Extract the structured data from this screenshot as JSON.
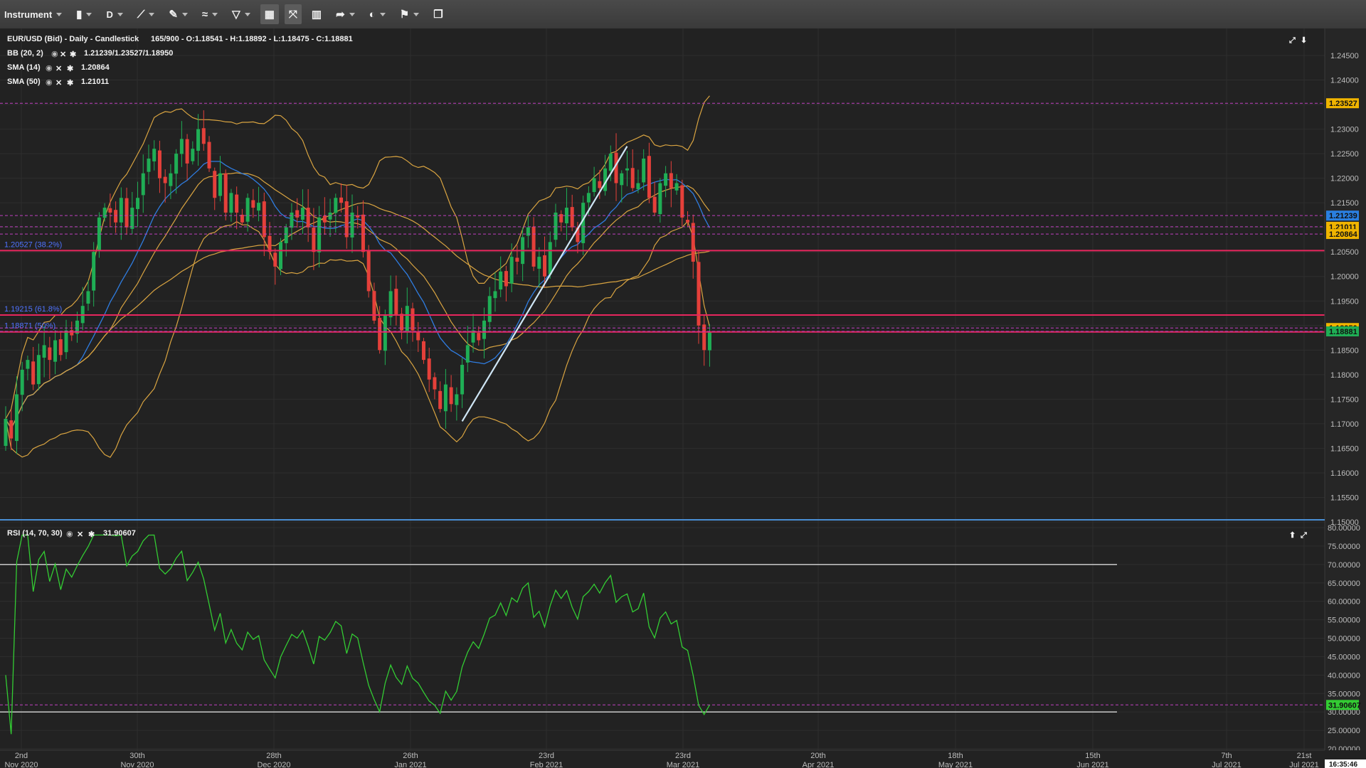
{
  "toolbar": {
    "instrument_label": "Instrument",
    "timeframe_label": "D",
    "icons": [
      "candlestick-type-icon",
      "line-draw-icon",
      "pencil-icon",
      "indicator-icon",
      "shape-icon",
      "layout-icon",
      "fullscreen-icon",
      "bar-chart-icon",
      "share-arrow-icon",
      "theme-icon",
      "uk-flag-icon",
      "detach-window-icon"
    ]
  },
  "header": {
    "instrument": "EUR/USD (Bid) - Daily - Candlestick",
    "ohlc": "165/900 - O:1.18541 - H:1.18892 - L:1.18475 - C:1.18881",
    "bb_label": "BB (20, 2)",
    "bb_values": "1.21239/1.23527/1.18950",
    "sma14_label": "SMA (14)",
    "sma14_value": "1.20864",
    "sma50_label": "SMA (50)",
    "sma50_value": "1.21011"
  },
  "rsi_header": {
    "label": "RSI (14, 70, 30)",
    "value": "31.90607"
  },
  "fib_labels": [
    {
      "text": "1.20527 (38.2%)",
      "price": 1.20527
    },
    {
      "text": "1.18871 (50%)",
      "price": 1.18871
    },
    {
      "text": "1.19215 (61.8%)",
      "price": 1.19215
    }
  ],
  "price_badges": [
    {
      "text": "1.23527",
      "price": 1.23527,
      "color": "#f0b400"
    },
    {
      "text": "1.21239",
      "price": 1.21239,
      "color": "#2a7fe0"
    },
    {
      "text": "1.21011",
      "price": 1.21011,
      "color": "#f0b400"
    },
    {
      "text": "1.20864",
      "price": 1.20864,
      "color": "#f0b400"
    },
    {
      "text": "1.18950",
      "price": 1.1895,
      "color": "#f0b400"
    },
    {
      "text": "1.18881",
      "price": 1.18881,
      "color": "#1fae55"
    }
  ],
  "rsi_badge": {
    "text": "31.90607",
    "value": 31.90607,
    "color": "#33cc33"
  },
  "date_ticks": [
    {
      "day": "2nd",
      "month": "Nov 2020"
    },
    {
      "day": "30th",
      "month": "Nov 2020"
    },
    {
      "day": "28th",
      "month": "Dec 2020"
    },
    {
      "day": "26th",
      "month": "Jan 2021"
    },
    {
      "day": "23rd",
      "month": "Feb 2021"
    },
    {
      "day": "23rd",
      "month": "Mar 2021"
    },
    {
      "day": "20th",
      "month": "Apr 2021"
    },
    {
      "day": "18th",
      "month": "May 2021"
    },
    {
      "day": "15th",
      "month": "Jun 2021"
    },
    {
      "day": "7th",
      "month": "Jul 2021"
    },
    {
      "day": "21st",
      "month": "Jul 2021"
    }
  ],
  "time_readout": "16:35:46",
  "colors": {
    "up": "#1fae55",
    "down": "#e5403a",
    "bb": "#d9a441",
    "sma14": "#2f7de1",
    "sma50": "#d9a441",
    "rsi": "#33cc33",
    "fib": "#e8265e",
    "dashed": "#c040c0"
  },
  "chart_data": [
    {
      "type": "candlestick",
      "title": "EUR/USD (Bid) - Daily - Candlestick",
      "x": [
        "2020-11-02",
        "2020-11-30",
        "2020-12-28",
        "2021-01-26",
        "2021-02-23",
        "2021-03-23",
        "2021-04-20",
        "2021-05-18",
        "2021-06-15",
        "2021-07-07",
        "2021-07-21"
      ],
      "ylim": [
        1.15,
        1.245
      ],
      "y_ticks": [
        1.15,
        1.155,
        1.16,
        1.165,
        1.17,
        1.175,
        1.18,
        1.185,
        1.19,
        1.195,
        1.2,
        1.205,
        1.21,
        1.215,
        1.22,
        1.225,
        1.23,
        1.235,
        1.24,
        1.245
      ],
      "close_series": [
        1.171,
        1.167,
        1.176,
        1.181,
        1.183,
        1.178,
        1.184,
        1.186,
        1.183,
        1.187,
        1.184,
        1.189,
        1.188,
        1.191,
        1.194,
        1.197,
        1.205,
        1.212,
        1.214,
        1.213,
        1.211,
        1.216,
        1.21,
        1.214,
        1.216,
        1.221,
        1.224,
        1.226,
        1.22,
        1.219,
        1.221,
        1.225,
        1.228,
        1.223,
        1.226,
        1.23,
        1.227,
        1.222,
        1.216,
        1.221,
        1.213,
        1.217,
        1.213,
        1.211,
        1.216,
        1.214,
        1.215,
        1.208,
        1.205,
        1.202,
        1.207,
        1.21,
        1.213,
        1.212,
        1.214,
        1.21,
        1.205,
        1.212,
        1.211,
        1.213,
        1.216,
        1.215,
        1.208,
        1.213,
        1.212,
        1.205,
        1.197,
        1.191,
        1.185,
        1.192,
        1.197,
        1.192,
        1.189,
        1.194,
        1.189,
        1.187,
        1.183,
        1.179,
        1.177,
        1.173,
        1.178,
        1.174,
        1.176,
        1.182,
        1.186,
        1.189,
        1.187,
        1.191,
        1.196,
        1.197,
        1.201,
        1.198,
        1.204,
        1.203,
        1.208,
        1.21,
        1.202,
        1.204,
        1.2,
        1.207,
        1.213,
        1.211,
        1.214,
        1.21,
        1.207,
        1.215,
        1.217,
        1.22,
        1.218,
        1.222,
        1.225,
        1.219,
        1.221,
        1.222,
        1.218,
        1.219,
        1.224,
        1.216,
        1.213,
        1.219,
        1.221,
        1.218,
        1.219,
        1.212,
        1.211,
        1.203,
        1.19,
        1.185,
        1.1888
      ],
      "series": [
        {
          "name": "BB (20, 2)",
          "last": [
            1.21239,
            1.23527,
            1.1895
          ]
        },
        {
          "name": "SMA (14)",
          "last": 1.20864
        },
        {
          "name": "SMA (50)",
          "last": 1.21011
        }
      ],
      "fibonacci": [
        {
          "label": "38.2%",
          "price": 1.20527
        },
        {
          "label": "50%",
          "price": 1.18871
        },
        {
          "label": "61.8%",
          "price": 1.19215
        }
      ],
      "trendline": {
        "from": 1.1705,
        "to": 1.2265
      }
    },
    {
      "type": "line",
      "title": "RSI (14, 70, 30)",
      "ylim": [
        20,
        80
      ],
      "y_ticks": [
        20,
        25,
        30,
        35,
        40,
        45,
        50,
        55,
        60,
        65,
        70,
        75,
        80
      ],
      "levels": [
        70,
        30
      ],
      "last": 31.90607
    }
  ]
}
